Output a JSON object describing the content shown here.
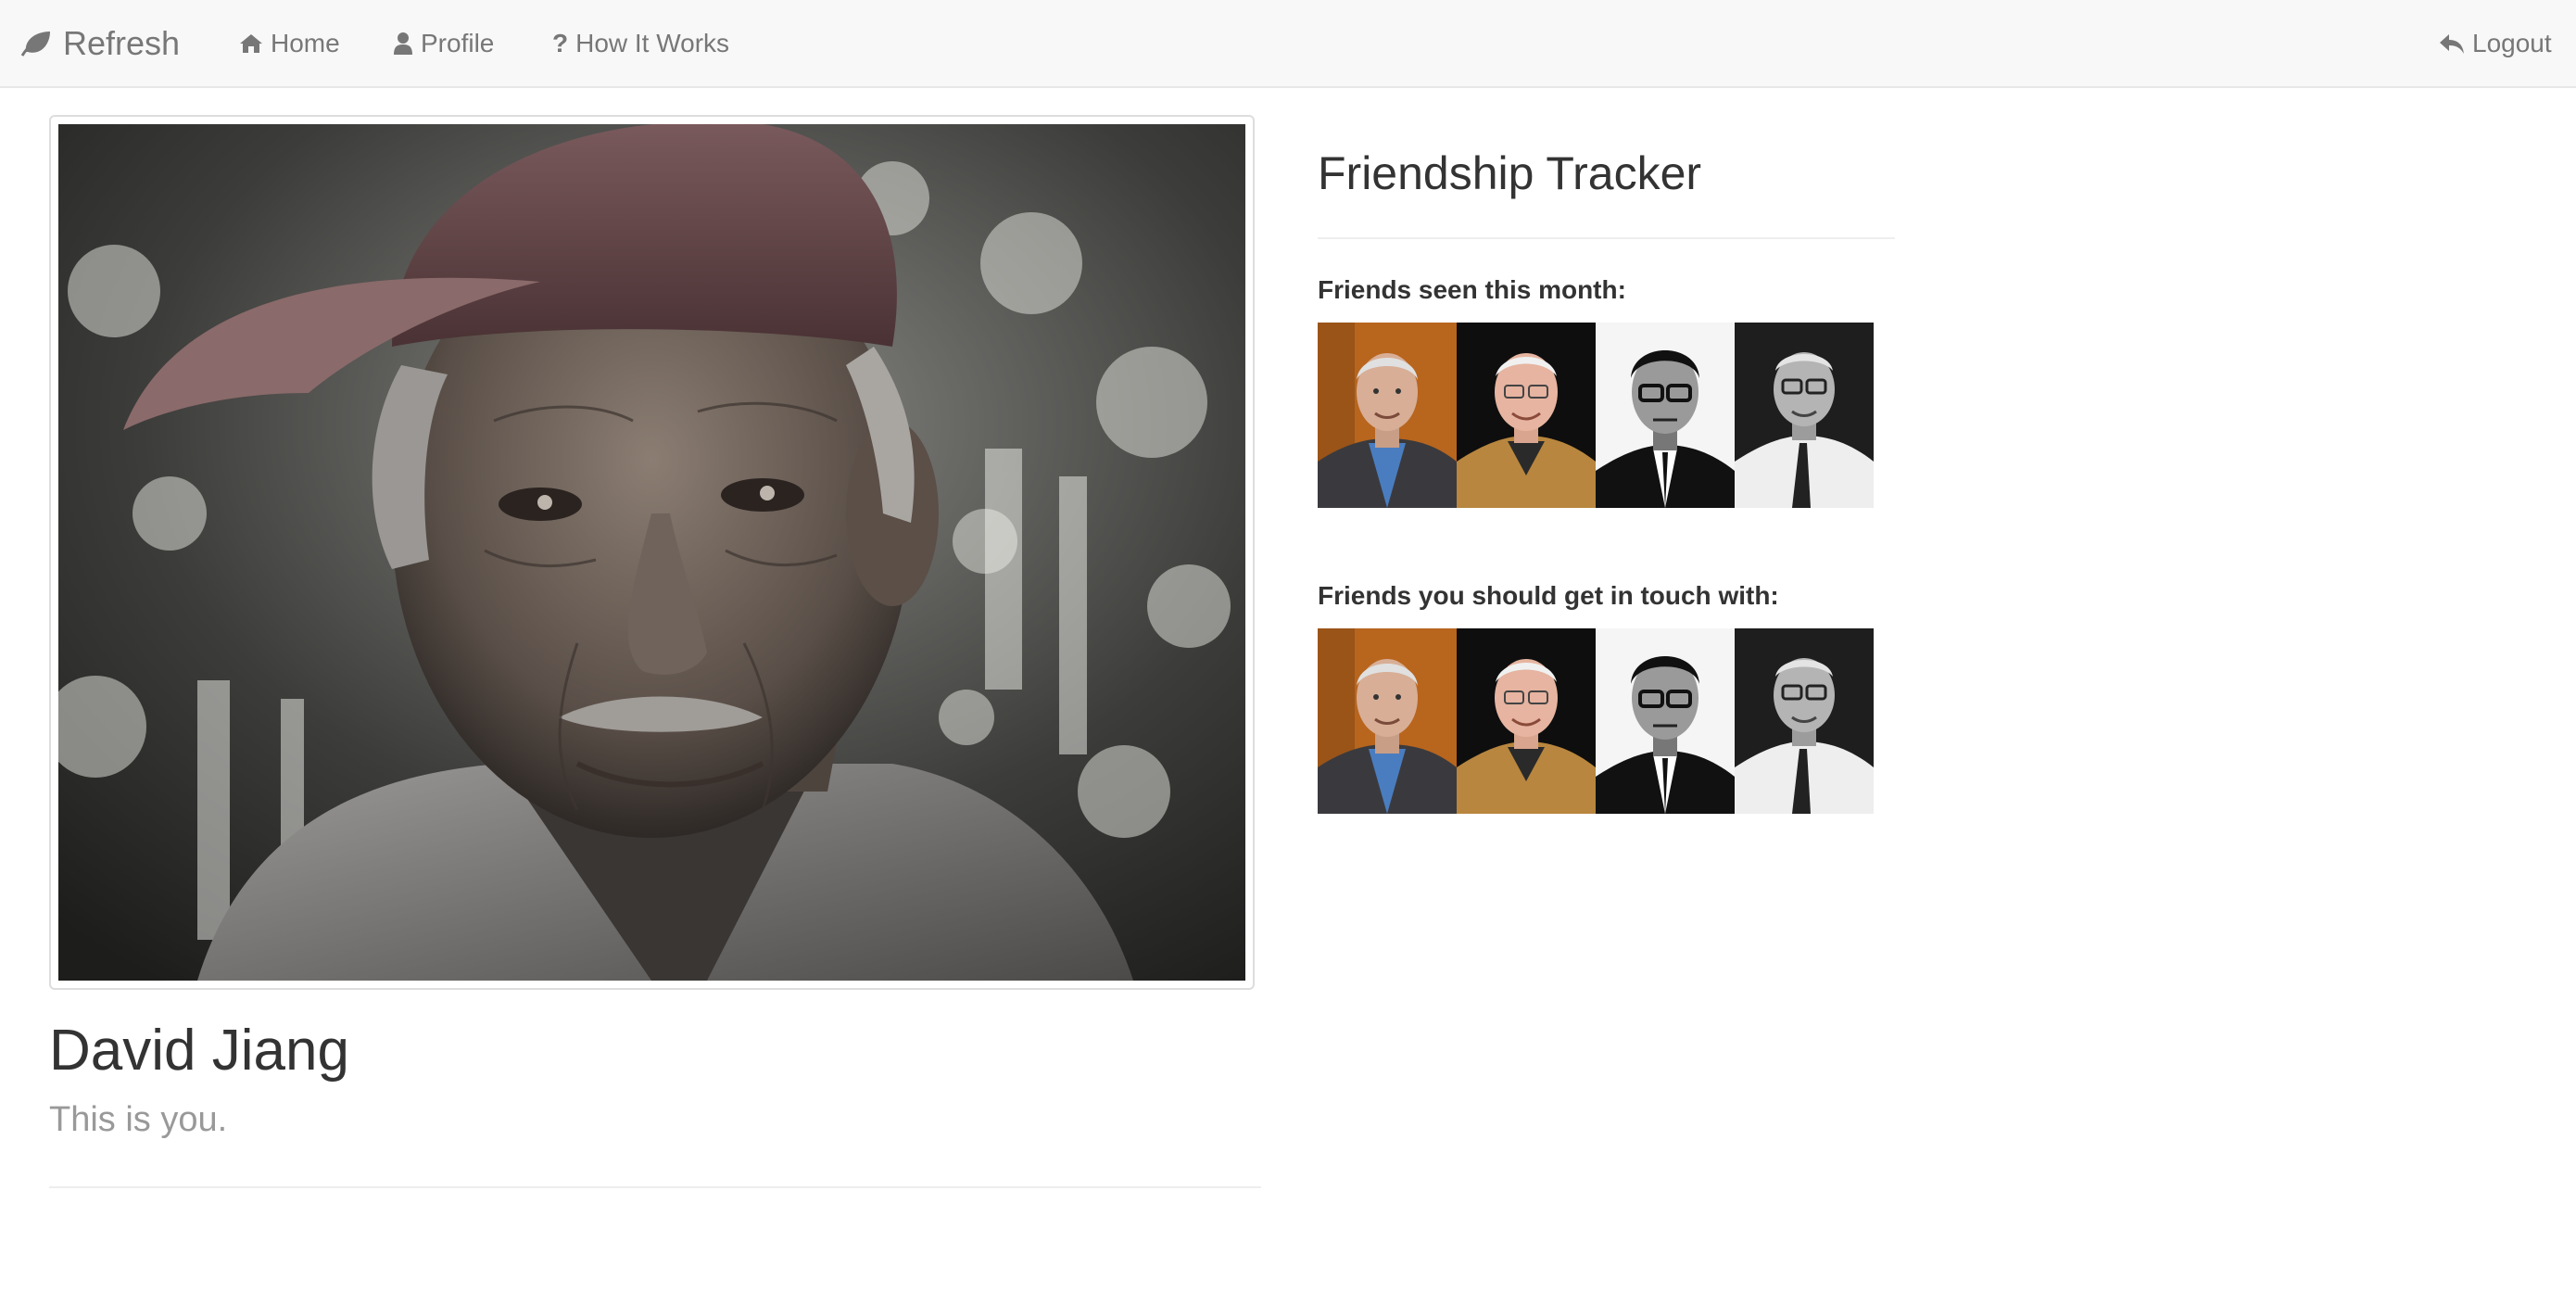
{
  "navbar": {
    "brand": "Refresh",
    "brand_icon": "leaf-icon",
    "home": "Home",
    "profile": "Profile",
    "how_it_works": "How It Works",
    "logout": "Logout"
  },
  "profile": {
    "name": "David Jiang",
    "subtitle": "This is you."
  },
  "tracker": {
    "title": "Friendship Tracker",
    "seen_label": "Friends seen this month:",
    "touch_label": "Friends you should get in touch with:"
  },
  "colors": {
    "navbar_bg": "#f8f8f8",
    "nav_text": "#777777",
    "heading_text": "#333333",
    "muted_text": "#999999"
  }
}
